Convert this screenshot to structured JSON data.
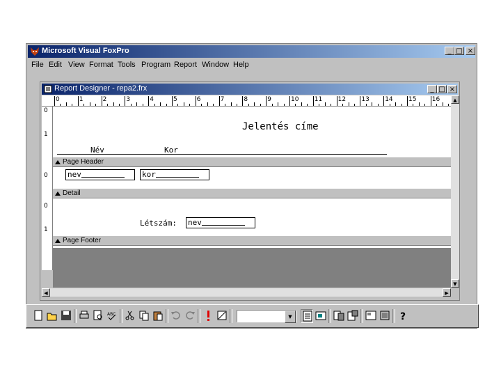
{
  "app": {
    "title": "Microsoft Visual FoxPro",
    "menu": [
      "File",
      "Edit",
      "View",
      "Format",
      "Tools",
      "Program",
      "Report",
      "Window",
      "Help"
    ],
    "caption_buttons": [
      "_",
      "□",
      "×"
    ]
  },
  "designer": {
    "title": "Report Designer - repa2.frx",
    "ruler": [
      "0",
      "1",
      "2",
      "3",
      "4",
      "5",
      "6",
      "7",
      "8",
      "9",
      "10",
      "11",
      "12",
      "13",
      "14",
      "15",
      "16"
    ],
    "vruler": {
      "header": [
        "0",
        "1"
      ],
      "detail": [
        "0"
      ],
      "footer": [
        "0",
        "1"
      ]
    },
    "page_header": {
      "report_title": "Jelentés címe",
      "col_name": "Név",
      "col_age": "Kor",
      "band_label": "Page Header"
    },
    "detail": {
      "field_name": "nev",
      "field_age": "kor",
      "band_label": "Detail"
    },
    "page_footer": {
      "count_label": "Létszám:",
      "count_field": "nev",
      "band_label": "Page Footer"
    }
  },
  "toolbar": {
    "combo_value": "",
    "icons": [
      "new-icon",
      "open-icon",
      "save-icon",
      "print-icon",
      "print-preview-icon",
      "spell-check-icon",
      "cut-icon",
      "copy-icon",
      "paste-icon",
      "undo-icon",
      "redo-icon",
      "run-icon",
      "modify-form-icon",
      "layout-icon",
      "form-wizard-icon",
      "data-session-icon",
      "properties-icon",
      "code-window-icon",
      "form-control-icon",
      "help-icon"
    ]
  }
}
